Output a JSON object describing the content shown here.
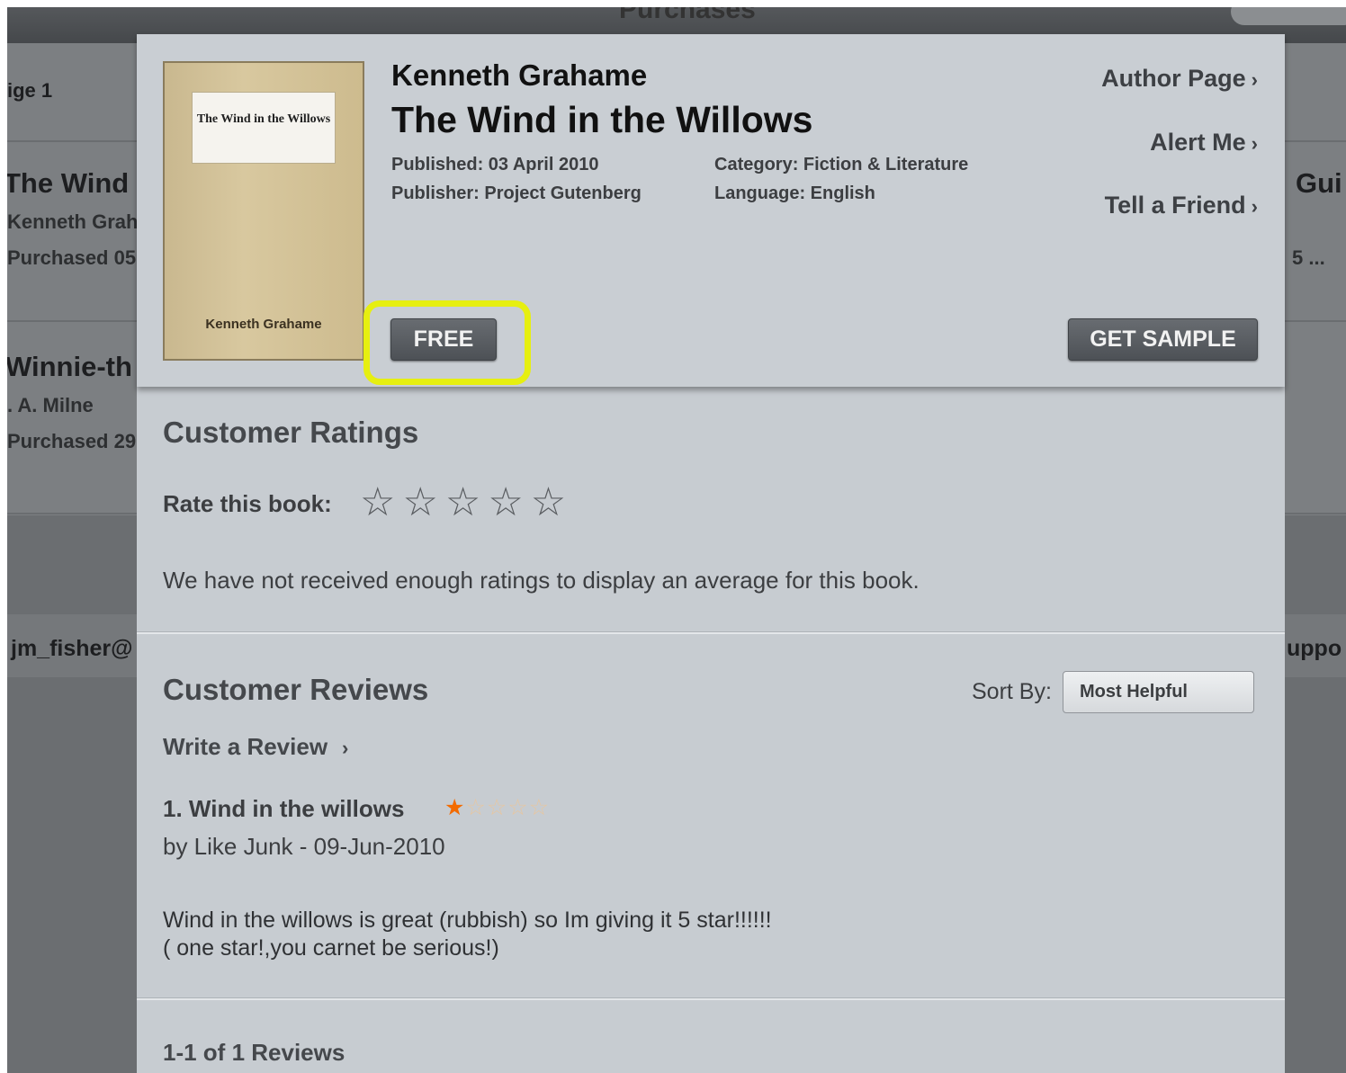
{
  "background": {
    "top_title": "Purchases",
    "page_label": "ige 1",
    "items": [
      {
        "title": "The Wind",
        "author": "Kenneth Grah",
        "purchased": "Purchased 05"
      },
      {
        "title": "Winnie-th",
        "author": ". A. Milne",
        "purchased": "Purchased 29"
      }
    ],
    "right_items": [
      {
        "title": "Gui",
        "sub": "5 ..."
      }
    ],
    "account": "jm_fisher@",
    "support": "uppo"
  },
  "book": {
    "author": "Kenneth Grahame",
    "title": "The Wind in the Willows",
    "cover_title": "The Wind in the Willows",
    "cover_author": "Kenneth Grahame",
    "published": "Published: 03 April 2010",
    "publisher": "Publisher: Project Gutenberg",
    "category": "Category: Fiction & Literature",
    "language": "Language: English"
  },
  "links": {
    "author_page": "Author Page",
    "alert_me": "Alert Me",
    "tell_friend": "Tell a Friend",
    "chevron": "›"
  },
  "buttons": {
    "free": "FREE",
    "get_sample": "GET SAMPLE"
  },
  "ratings": {
    "heading": "Customer Ratings",
    "rate_label": "Rate this book:",
    "stars": "☆☆☆☆☆",
    "note": "We have not received enough ratings to display an average for this book."
  },
  "reviews": {
    "heading": "Customer Reviews",
    "sort_label": "Sort By:",
    "sort_value": "Most Helpful",
    "write": "Write a Review",
    "items": [
      {
        "title": "1. Wind in the willows",
        "rating": 1,
        "stars_on": "★",
        "stars_off": "☆☆☆☆",
        "byline": "by Like Junk - 09-Jun-2010",
        "body_line1": "Wind in the willows is great (rubbish) so Im giving it 5 star!!!!!!",
        "body_line2": "( one star!,you carnet be serious!)"
      }
    ],
    "count": "1-1 of 1 Reviews"
  },
  "colors": {
    "highlight": "#e6ef10",
    "button": "#55595e",
    "review_star": "#f36b00"
  }
}
